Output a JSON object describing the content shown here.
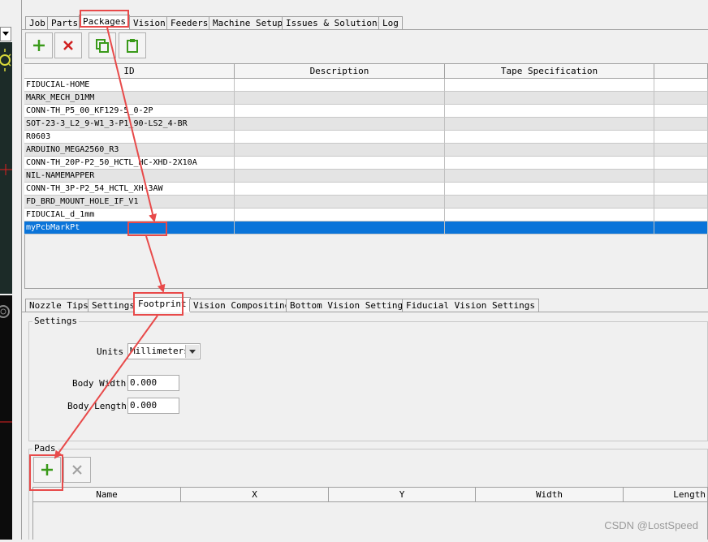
{
  "main_tabs": [
    {
      "label": "Job"
    },
    {
      "label": "Parts"
    },
    {
      "label": "Packages"
    },
    {
      "label": "Vision"
    },
    {
      "label": "Feeders"
    },
    {
      "label": "Machine Setup"
    },
    {
      "label": "Issues & Solutions"
    },
    {
      "label": "Log"
    }
  ],
  "packages_toolbar": {
    "add_icon": "plus-icon",
    "delete_icon": "x-icon",
    "copy_icon": "copy-icon",
    "paste_icon": "paste-icon"
  },
  "packages_table": {
    "columns": [
      "ID",
      "Description",
      "Tape Specification"
    ],
    "rows": [
      {
        "id": "FIDUCIAL-HOME",
        "description": "",
        "tape": ""
      },
      {
        "id": "MARK_MECH_D1MM",
        "description": "",
        "tape": ""
      },
      {
        "id": "CONN-TH_P5_00_KF129-5_0-2P",
        "description": "",
        "tape": ""
      },
      {
        "id": "SOT-23-3_L2_9-W1_3-P1_90-LS2_4-BR",
        "description": "",
        "tape": ""
      },
      {
        "id": "R0603",
        "description": "",
        "tape": ""
      },
      {
        "id": "ARDUINO_MEGA2560_R3",
        "description": "",
        "tape": ""
      },
      {
        "id": "CONN-TH_20P-P2_50_HCTL_HC-XHD-2X10A",
        "description": "",
        "tape": ""
      },
      {
        "id": "NIL-NAMEMAPPER",
        "description": "",
        "tape": ""
      },
      {
        "id": "CONN-TH_3P-P2_54_HCTL_XH-3AW",
        "description": "",
        "tape": ""
      },
      {
        "id": "FD_BRD_MOUNT_HOLE_IF_V1",
        "description": "",
        "tape": ""
      },
      {
        "id": "FIDUCIAL_d_1mm",
        "description": "",
        "tape": ""
      },
      {
        "id": "myPcbMarkPt",
        "description": "",
        "tape": ""
      }
    ],
    "selected_index": 11
  },
  "package_tabs": [
    {
      "label": "Nozzle Tips"
    },
    {
      "label": "Settings"
    },
    {
      "label": "Footprint"
    },
    {
      "label": "Vision Compositing"
    },
    {
      "label": "Bottom Vision Settings"
    },
    {
      "label": "Fiducial Vision Settings"
    }
  ],
  "settings": {
    "title": "Settings",
    "units_label": "Units",
    "units_value": "Millimeters",
    "body_width_label": "Body Width",
    "body_width_value": "0.000",
    "body_length_label": "Body Length",
    "body_length_value": "0.000"
  },
  "pads": {
    "title": "Pads",
    "columns": [
      "Name",
      "X",
      "Y",
      "Width",
      "Length"
    ]
  },
  "watermark": "CSDN @LostSpeed",
  "colors": {
    "selection": "#0a74d9",
    "annotation": "#e84a4a",
    "add_green": "#3a9a1a",
    "delete_red": "#d02020"
  }
}
